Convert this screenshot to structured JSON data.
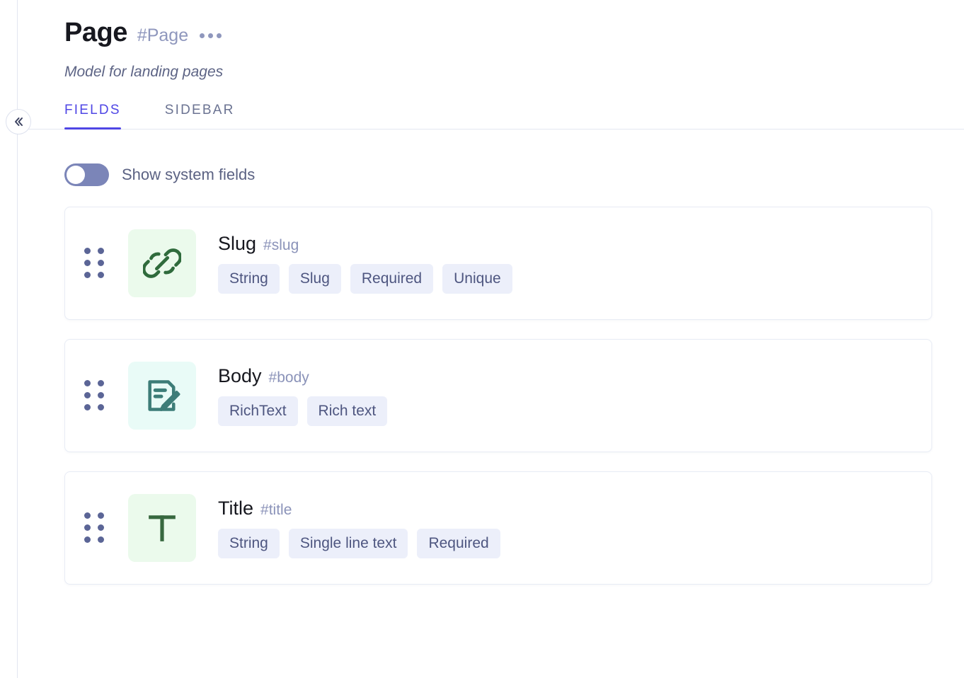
{
  "sidebar_rail": {
    "collapse_button": {
      "icon": "chevron-double-left-icon",
      "label": "«"
    }
  },
  "header": {
    "title": "Page",
    "api_key": "#Page",
    "overflow_menu_icon": "ellipsis-horizontal-icon",
    "description": "Model for landing pages"
  },
  "tabs": [
    {
      "label": "FIELDS",
      "active": true
    },
    {
      "label": "SIDEBAR",
      "active": false
    }
  ],
  "toggle": {
    "label": "Show system fields",
    "checked": false
  },
  "colors": {
    "accent": "#4f46e5",
    "muted_text": "#8f97bd",
    "chip_bg": "#eceffa",
    "chip_text": "#4e5680",
    "green_icon": "#2f6b3c",
    "green_bg": "#ebfaec",
    "teal_icon": "#3d7d78",
    "teal_bg": "#e9fbf7"
  },
  "fields": [
    {
      "name": "Slug",
      "api_key": "#slug",
      "icon": "link-chain-icon",
      "icon_bg": "#ebfaec",
      "icon_color": "#2f6b3c",
      "drag_handle_icon": "drag-handle-dots-icon",
      "chips": [
        "String",
        "Slug",
        "Required",
        "Unique"
      ]
    },
    {
      "name": "Body",
      "api_key": "#body",
      "icon": "document-pencil-icon",
      "icon_bg": "#e9fbf7",
      "icon_color": "#3d7d78",
      "drag_handle_icon": "drag-handle-dots-icon",
      "chips": [
        "RichText",
        "Rich text"
      ]
    },
    {
      "name": "Title",
      "api_key": "#title",
      "icon": "text-t-icon",
      "icon_bg": "#ebfaec",
      "icon_color": "#37683f",
      "drag_handle_icon": "drag-handle-dots-icon",
      "chips": [
        "String",
        "Single line text",
        "Required"
      ]
    }
  ]
}
